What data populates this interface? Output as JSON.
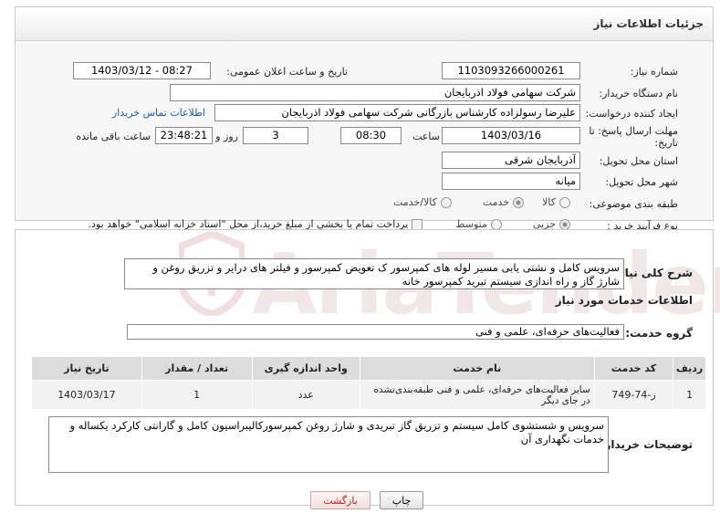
{
  "header": {
    "title": "جزئیات اطلاعات نیاز"
  },
  "fields": {
    "need_number_label": "شماره نیاز:",
    "need_number": "1103093266000261",
    "announce_label": "تاریخ و ساعت اعلان عمومی:",
    "announce_value": "1403/03/12 - 08:27",
    "buyer_org_label": "نام دستگاه خریدار:",
    "buyer_org": "شرکت سهامی فولاد اذربایجان",
    "requester_label": "ایجاد کننده درخواست:",
    "requester": "علیرضا رسولزاده کارشناس بازرگانی شرکت سهامی فولاد اذربایجان",
    "contact_link": "اطلاعات تماس خریدار",
    "deadline_label": "مهلت ارسال پاسخ: تا تاریخ:",
    "deadline_date": "1403/03/16",
    "time_label": "ساعت",
    "deadline_time": "08:30",
    "days_value": "3",
    "days_label": "روز و",
    "remaining_time": "23:48:21",
    "remaining_label": "ساعت باقی مانده",
    "province_label": "استان محل تحویل:",
    "province": "آذربایجان شرقی",
    "city_label": "شهر محل تحویل:",
    "city": "میانه",
    "category_label": "طبقه بندی موضوعی:",
    "category_options": [
      "کالا",
      "خدمت",
      "کالا/خدمت"
    ],
    "category_selected": 1,
    "process_label": "نوع فرآیند خرید :",
    "process_options": [
      "جزیی",
      "متوسط"
    ],
    "process_selected": 0,
    "process_note": "پرداخت تمام یا بخشی از مبلغ خرید،از محل \"اسناد خزانه اسلامی\" خواهد بود."
  },
  "summary": {
    "label": "شرح کلی نیاز:",
    "text": "سرویس کامل و نشتی یابی مسیر لوله های کمپرسور ک تعویض کمپرسور و فیلتر های درایر و تزریق روغن و شارژ گاز و راه اندازی سیستم تبرید کمپرسور خانه"
  },
  "services": {
    "title": "اطلاعات خدمات مورد نیاز",
    "group_label": "گروه خدمت:",
    "group_value": "فعالیت‌های حرفه‌ای، علمی و فنی",
    "columns": [
      "ردیف",
      "کد خدمت",
      "نام خدمت",
      "واحد اندازه گیری",
      "تعداد / مقدار",
      "تاریخ نیاز"
    ],
    "rows": [
      [
        "1",
        "ز-74-749",
        "سایر فعالیت‌های حرفه‌ای، علمی و فنی طبقه‌بندی‌نشده در جای دیگر",
        "عدد",
        "1",
        "1403/03/17"
      ]
    ]
  },
  "buyer_notes": {
    "label": "توضیحات خریدار:",
    "text": "سرویس و شستشوی کامل سیستم و تزریق گاز تبریدی و شارژ روغن کمپرسورکالیبراسیون کامل و گارانتی کارکرد یکساله و خدمات نگهداری آن"
  },
  "buttons": {
    "print": "چاپ",
    "back": "بازگشت"
  },
  "watermark": "AriaTender.neT"
}
